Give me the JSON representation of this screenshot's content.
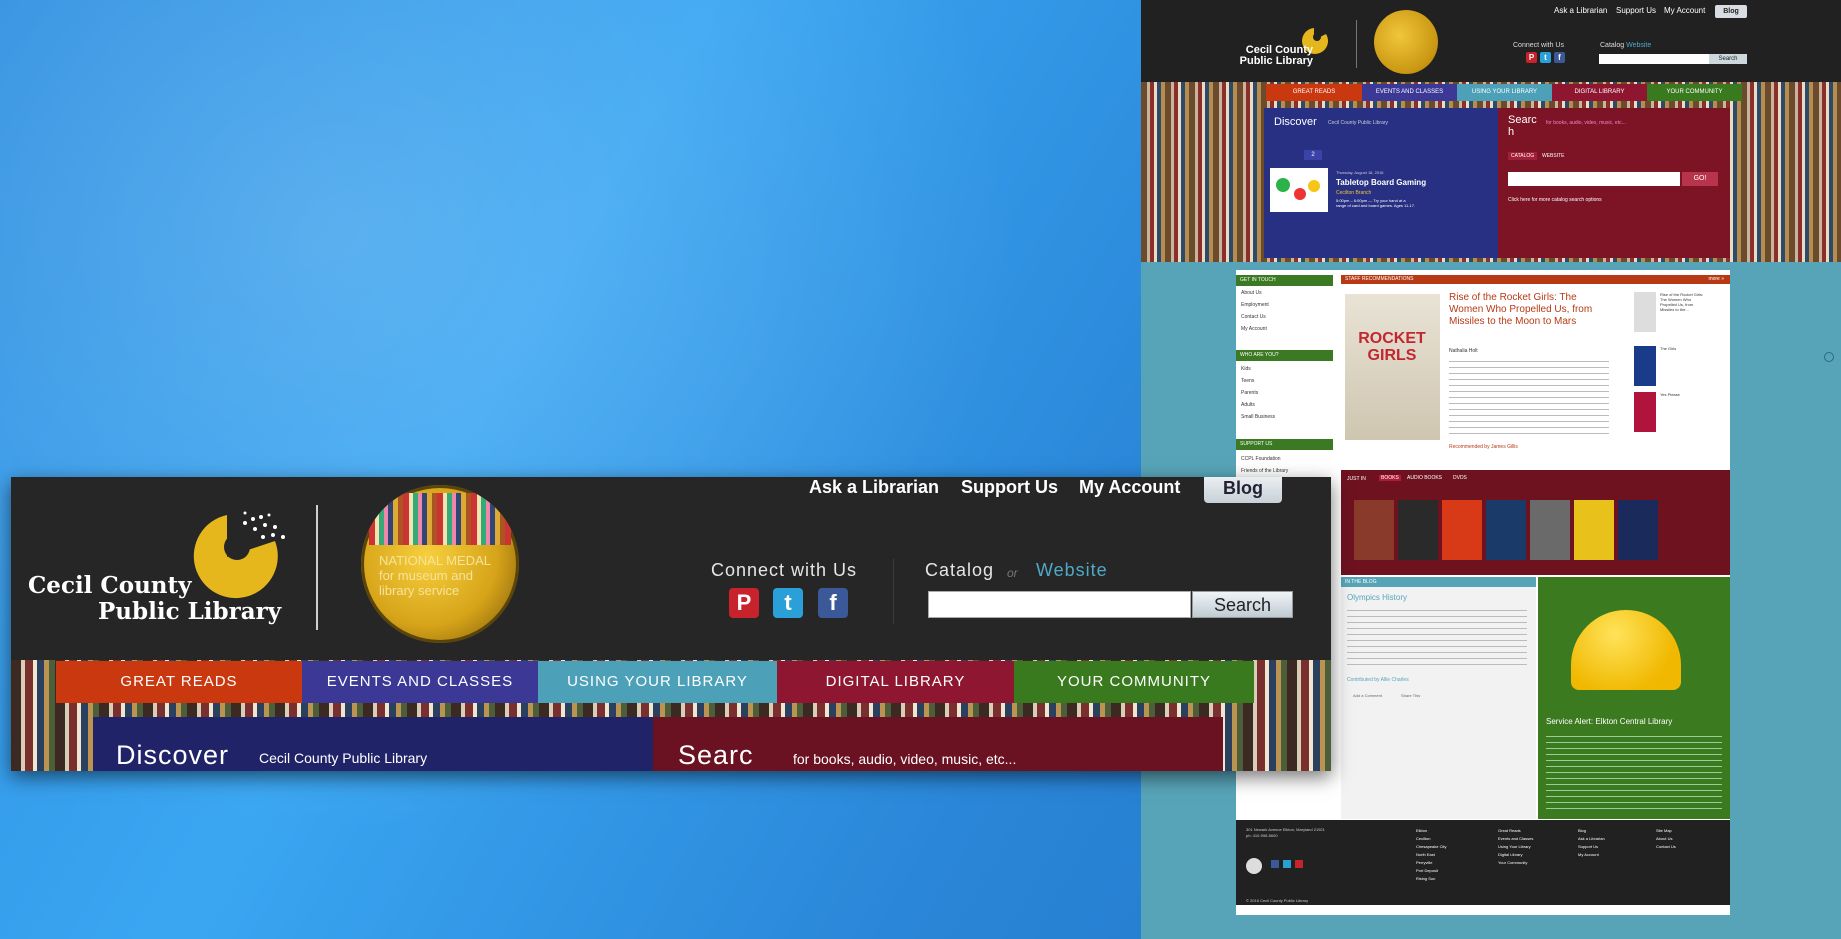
{
  "zoom_header": {
    "utility_links": [
      "Ask a Librarian",
      "Support Us",
      "My Account"
    ],
    "blog_button": "Blog",
    "logo_line1": "Cecil County",
    "logo_line2": "Public Library",
    "medal_text": "NATIONAL MEDAL for museum and library service",
    "connect_label": "Connect with Us",
    "social_icons": [
      "pinterest-icon",
      "twitter-icon",
      "facebook-icon"
    ],
    "catalog_label": "Catalog",
    "or_label": "or",
    "website_label": "Website",
    "search_value": "",
    "search_button": "Search",
    "nav": [
      {
        "label": "GREAT READS",
        "color": "#c9380f"
      },
      {
        "label": "EVENTS AND CLASSES",
        "color": "#3b3896"
      },
      {
        "label": "USING YOUR LIBRARY",
        "color": "#4ca1b8"
      },
      {
        "label": "DIGITAL LIBRARY",
        "color": "#8e1630"
      },
      {
        "label": "YOUR COMMUNITY",
        "color": "#3a7a1f"
      }
    ],
    "discover_title": "Discover",
    "discover_subtitle": "Cecil County Public Library",
    "search_title": "Searc",
    "search_subtitle": "for books, audio, video, music, etc..."
  },
  "full_page": {
    "utility_links": [
      "Ask a Librarian",
      "Support Us",
      "My Account"
    ],
    "blog_button": "Blog",
    "logo_line1": "Cecil County",
    "logo_line2": "Public Library",
    "connect_label": "Connect with Us",
    "catalog_label": "Catalog",
    "website_label": "Website",
    "search_button": "Search",
    "nav": [
      "GREAT READS",
      "EVENTS AND CLASSES",
      "USING YOUR LIBRARY",
      "DIGITAL LIBRARY",
      "YOUR COMMUNITY"
    ],
    "discover_title": "Discover",
    "discover_subtitle": "Cecil County Public Library",
    "discover_tab": "2",
    "event_date": "Thursday, August 18, 2016",
    "event_title": "Tabletop Board Gaming",
    "event_branch": "Cecilton Branch",
    "event_time": "5:00pm – 6:00pm — Try your hand at a range of card and board games. Ages 11-17.",
    "search_title": "Searc h",
    "search_subtitle": "for books, audio, video, music, etc...",
    "search_tabs": [
      "CATALOG",
      "WEBSITE"
    ],
    "go_button": "GO!",
    "search_help": "Click here for more catalog search options",
    "sidebar": [
      {
        "heading": "GET IN TOUCH",
        "items": [
          "About Us",
          "Employment",
          "Contact Us",
          "My Account"
        ]
      },
      {
        "heading": "WHO ARE YOU?",
        "items": [
          "Kids",
          "Teens",
          "Parents",
          "Adults",
          "Small Business"
        ]
      },
      {
        "heading": "SUPPORT US",
        "items": [
          "CCPL Foundation",
          "Friends of the Library"
        ]
      }
    ],
    "staff_heading": "STAFF RECOMMENDATIONS",
    "staff_more": "more »",
    "book_cover_text": "ROCKET GIRLS",
    "book_title": "Rise of the Rocket Girls: The Women Who Propelled Us, from Missiles to the Moon to Mars",
    "book_author": "Nathalia Holt",
    "recommended_by": "Recommended by James Gillis",
    "side_books": [
      {
        "title": "Rise of the Rocket Girls: The Women Who Propelled Us, from Missiles to the...",
        "author": "Nathalia Holt"
      },
      {
        "title": "The Girls",
        "author": "Emma Cline"
      },
      {
        "title": "Yes Please",
        "author": "Amy Poehler"
      }
    ],
    "just_in_label": "JUST IN",
    "just_in_tabs": [
      "BOOKS",
      "AUDIO BOOKS",
      "DVDS"
    ],
    "cover_colors": [
      "#8a3a2a",
      "#2a2a2a",
      "#d83a18",
      "#1a3a6a",
      "#6a6a6a",
      "#e8c21a",
      "#1a2a5a"
    ],
    "blog_heading": "IN THE BLOG",
    "blog_post_title": "Olympics History",
    "blog_contributor": "Contributed by Allie Charles",
    "blog_actions": [
      "Add a Comment",
      "Share This"
    ],
    "alert_title": "Service Alert: Elkton Central Library",
    "footer_address": "301 Newark Avenue Elkton, Maryland 21921",
    "footer_phone": "ph: 410-996-5600",
    "footer_cols": [
      [
        "Elkton",
        "Cecilton",
        "Chesapeake City",
        "North East",
        "Perryville",
        "Port Deposit",
        "Rising Sun"
      ],
      [
        "Great Reads",
        "Events and Classes",
        "Using Your Library",
        "Digital Library",
        "Your Community"
      ],
      [
        "Blog",
        "Ask a Librarian",
        "Support Us",
        "My Account"
      ],
      [
        "Site Map",
        "About Us",
        "Contact Us"
      ]
    ],
    "copyright": "© 2016 Cecil County Public Library"
  }
}
